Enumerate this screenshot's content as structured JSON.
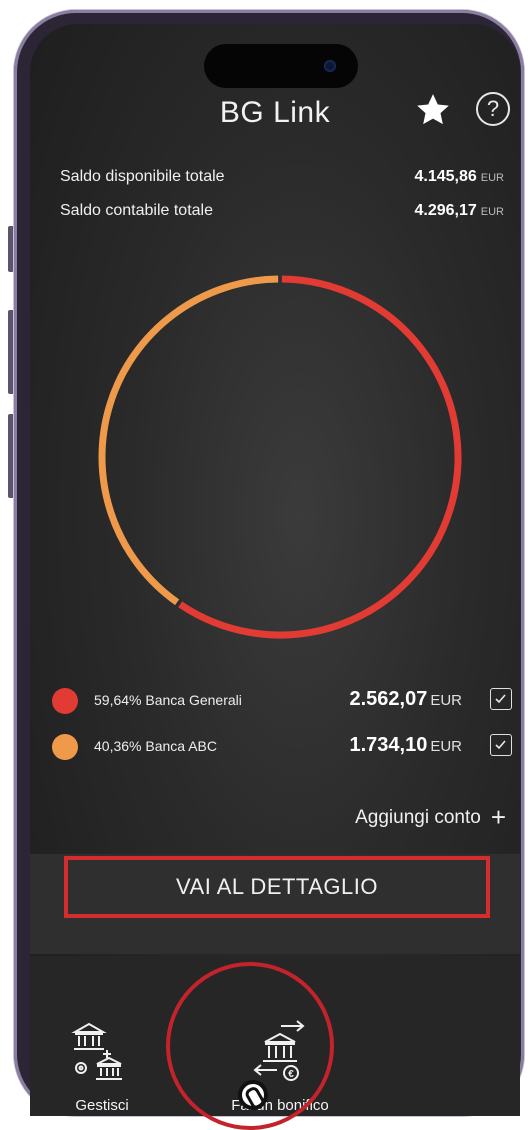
{
  "app": {
    "title": "BG Link"
  },
  "header": {
    "favorite_icon": "star-icon",
    "help_icon": "question-circle-icon",
    "help_glyph": "?"
  },
  "balances": {
    "available": {
      "label": "Saldo disponibile totale",
      "value": "4.145,86",
      "currency": "EUR"
    },
    "accounting": {
      "label": "Saldo contabile totale",
      "value": "4.296,17",
      "currency": "EUR"
    }
  },
  "chart_data": {
    "type": "pie",
    "style": "donut",
    "slices": [
      {
        "label": "Banca Generali",
        "value": 59.64,
        "color": "#e23b33"
      },
      {
        "label": "Banca ABC",
        "value": 40.36,
        "color": "#ef9a4a"
      }
    ]
  },
  "accounts": [
    {
      "percent": "59,64%",
      "name": "Banca Generali",
      "amount": "2.562,07",
      "currency": "EUR",
      "color": "#e23b33",
      "checked": true
    },
    {
      "percent": "40,36%",
      "name": "Banca ABC",
      "amount": "1.734,10",
      "currency": "EUR",
      "color": "#ef9a4a",
      "checked": true
    }
  ],
  "add_account": {
    "label": "Aggiungi conto",
    "icon": "plus-icon",
    "glyph": "+"
  },
  "detail_button": {
    "label": "VAI AL DETTAGLIO"
  },
  "bottom_nav": [
    {
      "label": "Gestisci\nConsensi",
      "icon": "bank-consent-icon"
    },
    {
      "label": "Fai un bonifico",
      "icon": "bank-transfer-icon"
    }
  ],
  "colors": {
    "accent_red": "#d42d2d",
    "orange": "#ef9a4a",
    "background": "#2a2a2a"
  }
}
